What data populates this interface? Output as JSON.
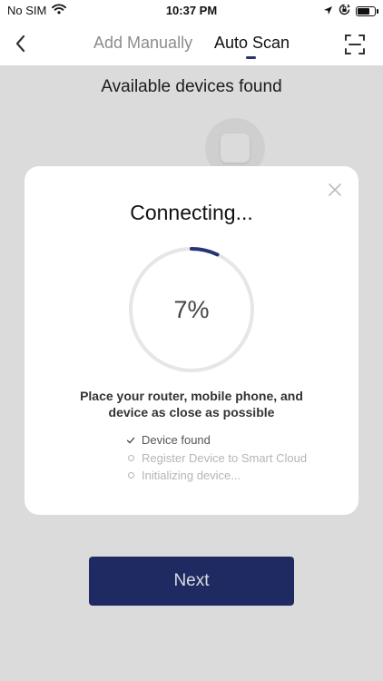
{
  "status_bar": {
    "carrier": "No SIM",
    "time": "10:37 PM",
    "battery_level": 0.7
  },
  "nav": {
    "back_icon": "chevron-left-icon",
    "tabs": [
      {
        "label": "Add Manually",
        "active": false
      },
      {
        "label": "Auto Scan",
        "active": true
      }
    ],
    "scan_icon": "scan-frame-icon"
  },
  "content": {
    "title": "Available devices found",
    "device_icon": "smart-device-icon"
  },
  "modal": {
    "title": "Connecting...",
    "progress_label": "7%",
    "progress_value": 0.07,
    "instruction": "Place your router, mobile phone, and device as close as possible",
    "steps": [
      {
        "label": "Device found",
        "status": "done"
      },
      {
        "label": "Register Device to Smart Cloud",
        "status": "pending"
      },
      {
        "label": "Initializing device...",
        "status": "pending"
      }
    ],
    "close_icon": "close-icon"
  },
  "footer": {
    "next_label": "Next"
  },
  "colors": {
    "accent": "#253273",
    "progress_track": "#e6e6e6",
    "progress_arc": "#263470",
    "overlay": "rgba(0,0,0,0.14)",
    "muted_text": "#b5b5b5"
  }
}
